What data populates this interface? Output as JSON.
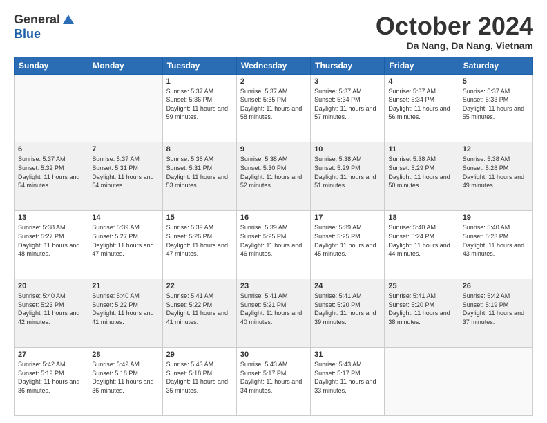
{
  "header": {
    "logo_general": "General",
    "logo_blue": "Blue",
    "month_title": "October 2024",
    "location": "Da Nang, Da Nang, Vietnam"
  },
  "days_of_week": [
    "Sunday",
    "Monday",
    "Tuesday",
    "Wednesday",
    "Thursday",
    "Friday",
    "Saturday"
  ],
  "weeks": [
    [
      {
        "day": "",
        "sunrise": "",
        "sunset": "",
        "daylight": ""
      },
      {
        "day": "",
        "sunrise": "",
        "sunset": "",
        "daylight": ""
      },
      {
        "day": "1",
        "sunrise": "Sunrise: 5:37 AM",
        "sunset": "Sunset: 5:36 PM",
        "daylight": "Daylight: 11 hours and 59 minutes."
      },
      {
        "day": "2",
        "sunrise": "Sunrise: 5:37 AM",
        "sunset": "Sunset: 5:35 PM",
        "daylight": "Daylight: 11 hours and 58 minutes."
      },
      {
        "day": "3",
        "sunrise": "Sunrise: 5:37 AM",
        "sunset": "Sunset: 5:34 PM",
        "daylight": "Daylight: 11 hours and 57 minutes."
      },
      {
        "day": "4",
        "sunrise": "Sunrise: 5:37 AM",
        "sunset": "Sunset: 5:34 PM",
        "daylight": "Daylight: 11 hours and 56 minutes."
      },
      {
        "day": "5",
        "sunrise": "Sunrise: 5:37 AM",
        "sunset": "Sunset: 5:33 PM",
        "daylight": "Daylight: 11 hours and 55 minutes."
      }
    ],
    [
      {
        "day": "6",
        "sunrise": "Sunrise: 5:37 AM",
        "sunset": "Sunset: 5:32 PM",
        "daylight": "Daylight: 11 hours and 54 minutes."
      },
      {
        "day": "7",
        "sunrise": "Sunrise: 5:37 AM",
        "sunset": "Sunset: 5:31 PM",
        "daylight": "Daylight: 11 hours and 54 minutes."
      },
      {
        "day": "8",
        "sunrise": "Sunrise: 5:38 AM",
        "sunset": "Sunset: 5:31 PM",
        "daylight": "Daylight: 11 hours and 53 minutes."
      },
      {
        "day": "9",
        "sunrise": "Sunrise: 5:38 AM",
        "sunset": "Sunset: 5:30 PM",
        "daylight": "Daylight: 11 hours and 52 minutes."
      },
      {
        "day": "10",
        "sunrise": "Sunrise: 5:38 AM",
        "sunset": "Sunset: 5:29 PM",
        "daylight": "Daylight: 11 hours and 51 minutes."
      },
      {
        "day": "11",
        "sunrise": "Sunrise: 5:38 AM",
        "sunset": "Sunset: 5:29 PM",
        "daylight": "Daylight: 11 hours and 50 minutes."
      },
      {
        "day": "12",
        "sunrise": "Sunrise: 5:38 AM",
        "sunset": "Sunset: 5:28 PM",
        "daylight": "Daylight: 11 hours and 49 minutes."
      }
    ],
    [
      {
        "day": "13",
        "sunrise": "Sunrise: 5:38 AM",
        "sunset": "Sunset: 5:27 PM",
        "daylight": "Daylight: 11 hours and 48 minutes."
      },
      {
        "day": "14",
        "sunrise": "Sunrise: 5:39 AM",
        "sunset": "Sunset: 5:27 PM",
        "daylight": "Daylight: 11 hours and 47 minutes."
      },
      {
        "day": "15",
        "sunrise": "Sunrise: 5:39 AM",
        "sunset": "Sunset: 5:26 PM",
        "daylight": "Daylight: 11 hours and 47 minutes."
      },
      {
        "day": "16",
        "sunrise": "Sunrise: 5:39 AM",
        "sunset": "Sunset: 5:25 PM",
        "daylight": "Daylight: 11 hours and 46 minutes."
      },
      {
        "day": "17",
        "sunrise": "Sunrise: 5:39 AM",
        "sunset": "Sunset: 5:25 PM",
        "daylight": "Daylight: 11 hours and 45 minutes."
      },
      {
        "day": "18",
        "sunrise": "Sunrise: 5:40 AM",
        "sunset": "Sunset: 5:24 PM",
        "daylight": "Daylight: 11 hours and 44 minutes."
      },
      {
        "day": "19",
        "sunrise": "Sunrise: 5:40 AM",
        "sunset": "Sunset: 5:23 PM",
        "daylight": "Daylight: 11 hours and 43 minutes."
      }
    ],
    [
      {
        "day": "20",
        "sunrise": "Sunrise: 5:40 AM",
        "sunset": "Sunset: 5:23 PM",
        "daylight": "Daylight: 11 hours and 42 minutes."
      },
      {
        "day": "21",
        "sunrise": "Sunrise: 5:40 AM",
        "sunset": "Sunset: 5:22 PM",
        "daylight": "Daylight: 11 hours and 41 minutes."
      },
      {
        "day": "22",
        "sunrise": "Sunrise: 5:41 AM",
        "sunset": "Sunset: 5:22 PM",
        "daylight": "Daylight: 11 hours and 41 minutes."
      },
      {
        "day": "23",
        "sunrise": "Sunrise: 5:41 AM",
        "sunset": "Sunset: 5:21 PM",
        "daylight": "Daylight: 11 hours and 40 minutes."
      },
      {
        "day": "24",
        "sunrise": "Sunrise: 5:41 AM",
        "sunset": "Sunset: 5:20 PM",
        "daylight": "Daylight: 11 hours and 39 minutes."
      },
      {
        "day": "25",
        "sunrise": "Sunrise: 5:41 AM",
        "sunset": "Sunset: 5:20 PM",
        "daylight": "Daylight: 11 hours and 38 minutes."
      },
      {
        "day": "26",
        "sunrise": "Sunrise: 5:42 AM",
        "sunset": "Sunset: 5:19 PM",
        "daylight": "Daylight: 11 hours and 37 minutes."
      }
    ],
    [
      {
        "day": "27",
        "sunrise": "Sunrise: 5:42 AM",
        "sunset": "Sunset: 5:19 PM",
        "daylight": "Daylight: 11 hours and 36 minutes."
      },
      {
        "day": "28",
        "sunrise": "Sunrise: 5:42 AM",
        "sunset": "Sunset: 5:18 PM",
        "daylight": "Daylight: 11 hours and 36 minutes."
      },
      {
        "day": "29",
        "sunrise": "Sunrise: 5:43 AM",
        "sunset": "Sunset: 5:18 PM",
        "daylight": "Daylight: 11 hours and 35 minutes."
      },
      {
        "day": "30",
        "sunrise": "Sunrise: 5:43 AM",
        "sunset": "Sunset: 5:17 PM",
        "daylight": "Daylight: 11 hours and 34 minutes."
      },
      {
        "day": "31",
        "sunrise": "Sunrise: 5:43 AM",
        "sunset": "Sunset: 5:17 PM",
        "daylight": "Daylight: 11 hours and 33 minutes."
      },
      {
        "day": "",
        "sunrise": "",
        "sunset": "",
        "daylight": ""
      },
      {
        "day": "",
        "sunrise": "",
        "sunset": "",
        "daylight": ""
      }
    ]
  ]
}
